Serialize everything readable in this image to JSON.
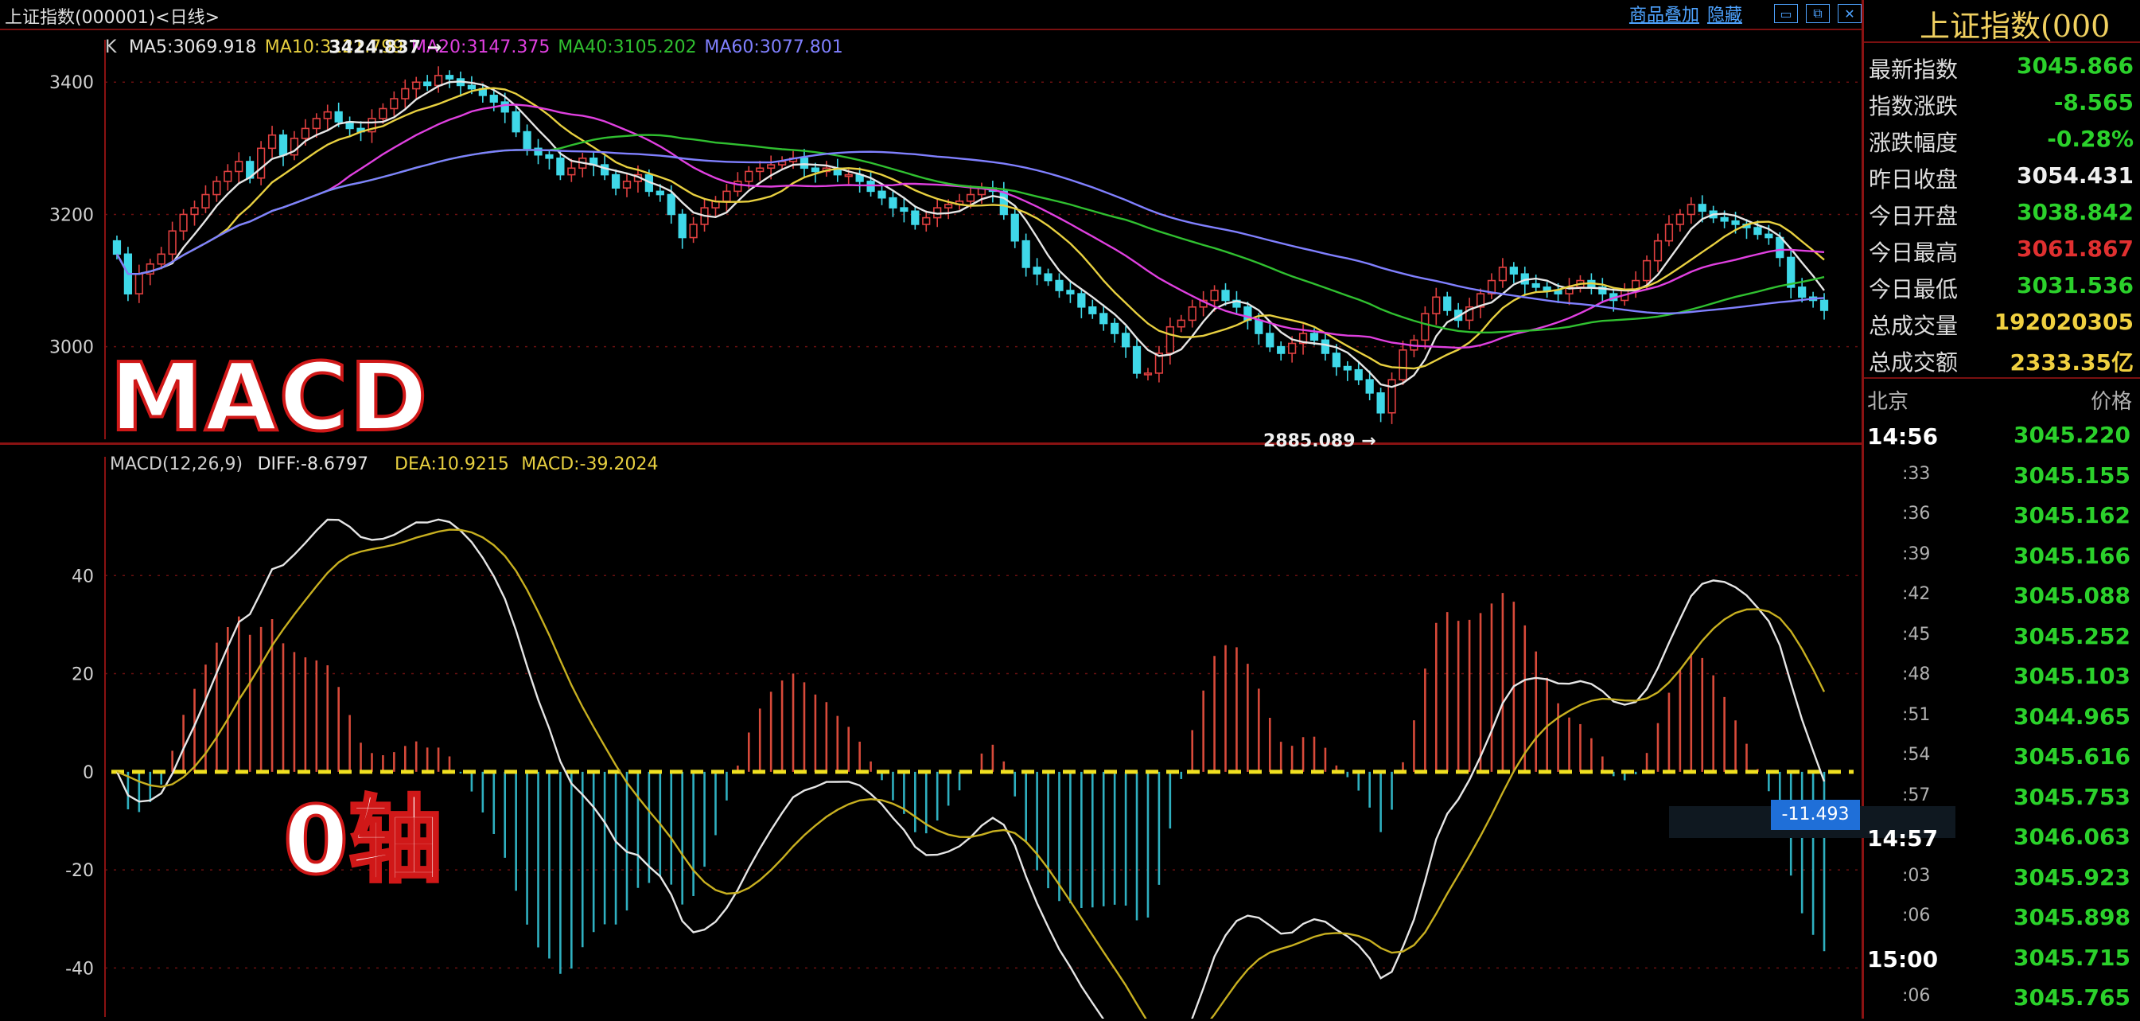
{
  "titlebar": {
    "title": "上证指数(000001)<日线>",
    "product_link": "商品叠加",
    "close_link": "隐藏",
    "window_buttons": [
      "minimize-icon",
      "restore-icon",
      "close-icon"
    ]
  },
  "overlay_labels": {
    "macd": "MACD",
    "zero_axis": "0轴"
  },
  "chart_data": [
    {
      "type": "candlestick",
      "legend_prefix": "K",
      "legend": [
        {
          "label": "MA5:3069.918",
          "color": "#e6e6e6"
        },
        {
          "label": "MA10:3121.799",
          "color": "#e8d040"
        },
        {
          "label": "MA20:3147.375",
          "color": "#e040e0"
        },
        {
          "label": "MA40:3105.202",
          "color": "#30c030"
        },
        {
          "label": "MA60:3077.801",
          "color": "#8080ff"
        }
      ],
      "y_ticks": [
        3000,
        3200,
        3400
      ],
      "ylim": [
        2860,
        3440
      ],
      "annotations": [
        {
          "text": "3424.837",
          "value": 3424.837,
          "index": 30,
          "side": "right"
        },
        {
          "text": "2885.089",
          "value": 2885.089,
          "index": 114,
          "side": "left"
        }
      ],
      "closes": [
        3140,
        3080,
        3110,
        3125,
        3140,
        3175,
        3200,
        3210,
        3230,
        3250,
        3265,
        3280,
        3255,
        3300,
        3320,
        3290,
        3315,
        3330,
        3345,
        3355,
        3340,
        3330,
        3325,
        3345,
        3360,
        3375,
        3390,
        3400,
        3395,
        3410,
        3405,
        3395,
        3390,
        3380,
        3370,
        3355,
        3325,
        3300,
        3290,
        3285,
        3260,
        3270,
        3285,
        3275,
        3260,
        3240,
        3250,
        3260,
        3235,
        3230,
        3200,
        3165,
        3185,
        3210,
        3220,
        3235,
        3250,
        3265,
        3270,
        3275,
        3280,
        3285,
        3270,
        3265,
        3270,
        3260,
        3260,
        3250,
        3235,
        3225,
        3210,
        3205,
        3185,
        3195,
        3210,
        3215,
        3220,
        3230,
        3240,
        3235,
        3200,
        3160,
        3120,
        3110,
        3100,
        3085,
        3080,
        3060,
        3050,
        3035,
        3020,
        3000,
        2960,
        2960,
        2990,
        3030,
        3040,
        3060,
        3070,
        3085,
        3070,
        3060,
        3040,
        3020,
        3000,
        2990,
        3005,
        3020,
        3010,
        2990,
        2970,
        2965,
        2950,
        2930,
        2900,
        2950,
        2995,
        3010,
        3050,
        3075,
        3055,
        3040,
        3060,
        3080,
        3100,
        3120,
        3110,
        3095,
        3090,
        3085,
        3080,
        3090,
        3100,
        3090,
        3080,
        3070,
        3085,
        3100,
        3130,
        3160,
        3185,
        3200,
        3215,
        3205,
        3195,
        3190,
        3185,
        3180,
        3170,
        3165,
        3135,
        3090,
        3075,
        3070,
        3055
      ],
      "moving_averages": [
        {
          "name": "MA5",
          "color": "#e6e6e6"
        },
        {
          "name": "MA10",
          "color": "#e8d040"
        },
        {
          "name": "MA20",
          "color": "#e040e0"
        },
        {
          "name": "MA40",
          "color": "#30c030"
        },
        {
          "name": "MA60",
          "color": "#8080ff"
        }
      ]
    },
    {
      "type": "macd",
      "legend": [
        {
          "label": "MACD(12,26,9)",
          "color": "#cfcfcf"
        },
        {
          "label": "DIFF:-8.6797",
          "color": "#e6e6e6"
        },
        {
          "label": "DEA:10.9215",
          "color": "#e8d040"
        },
        {
          "label": "MACD:-39.2024",
          "color": "#e8d040"
        }
      ],
      "y_ticks": [
        -40,
        -20,
        0,
        20,
        40
      ],
      "ylim": [
        -50,
        60
      ],
      "zero_line_color": "#f0e020",
      "diff_color": "#e6e6e6",
      "dea_color": "#c8b020",
      "hist_up_color": "#d84a3a",
      "hist_down_color": "#2fb0c0",
      "current_value": "-11.493"
    }
  ],
  "right_panel": {
    "title": "上证指数(000",
    "stats": [
      {
        "label": "最新指数",
        "value": "3045.866",
        "color": "#2bd12b"
      },
      {
        "label": "指数涨跌",
        "value": "-8.565",
        "color": "#2bd12b"
      },
      {
        "label": "涨跌幅度",
        "value": "-0.28%",
        "color": "#2bd12b"
      },
      {
        "label": "昨日收盘",
        "value": "3054.431",
        "color": "#f0f0f0"
      },
      {
        "label": "今日开盘",
        "value": "3038.842",
        "color": "#2bd12b"
      },
      {
        "label": "今日最高",
        "value": "3061.867",
        "color": "#e03030"
      },
      {
        "label": "今日最低",
        "value": "3031.536",
        "color": "#2bd12b"
      },
      {
        "label": "总成交量",
        "value": "192020305",
        "color": "#f0d040"
      },
      {
        "label": "总成交额",
        "value": "2333.35亿",
        "color": "#f0d040"
      }
    ],
    "tick_header": {
      "left": "北京",
      "right": "价格"
    },
    "ticks": [
      {
        "time": "14:56",
        "major": true,
        "price": "3045.220"
      },
      {
        "time": ":33",
        "major": false,
        "price": "3045.155"
      },
      {
        "time": ":36",
        "major": false,
        "price": "3045.162"
      },
      {
        "time": ":39",
        "major": false,
        "price": "3045.166"
      },
      {
        "time": ":42",
        "major": false,
        "price": "3045.088"
      },
      {
        "time": ":45",
        "major": false,
        "price": "3045.252"
      },
      {
        "time": ":48",
        "major": false,
        "price": "3045.103"
      },
      {
        "time": ":51",
        "major": false,
        "price": "3044.965"
      },
      {
        "time": ":54",
        "major": false,
        "price": "3045.616"
      },
      {
        "time": ":57",
        "major": false,
        "price": "3045.753"
      },
      {
        "time": "14:57",
        "major": true,
        "price": "3046.063"
      },
      {
        "time": ":03",
        "major": false,
        "price": "3045.923"
      },
      {
        "time": ":06",
        "major": false,
        "price": "3045.898"
      },
      {
        "time": "15:00",
        "major": true,
        "price": "3045.715"
      },
      {
        "time": ":06",
        "major": false,
        "price": "3045.765"
      }
    ]
  }
}
